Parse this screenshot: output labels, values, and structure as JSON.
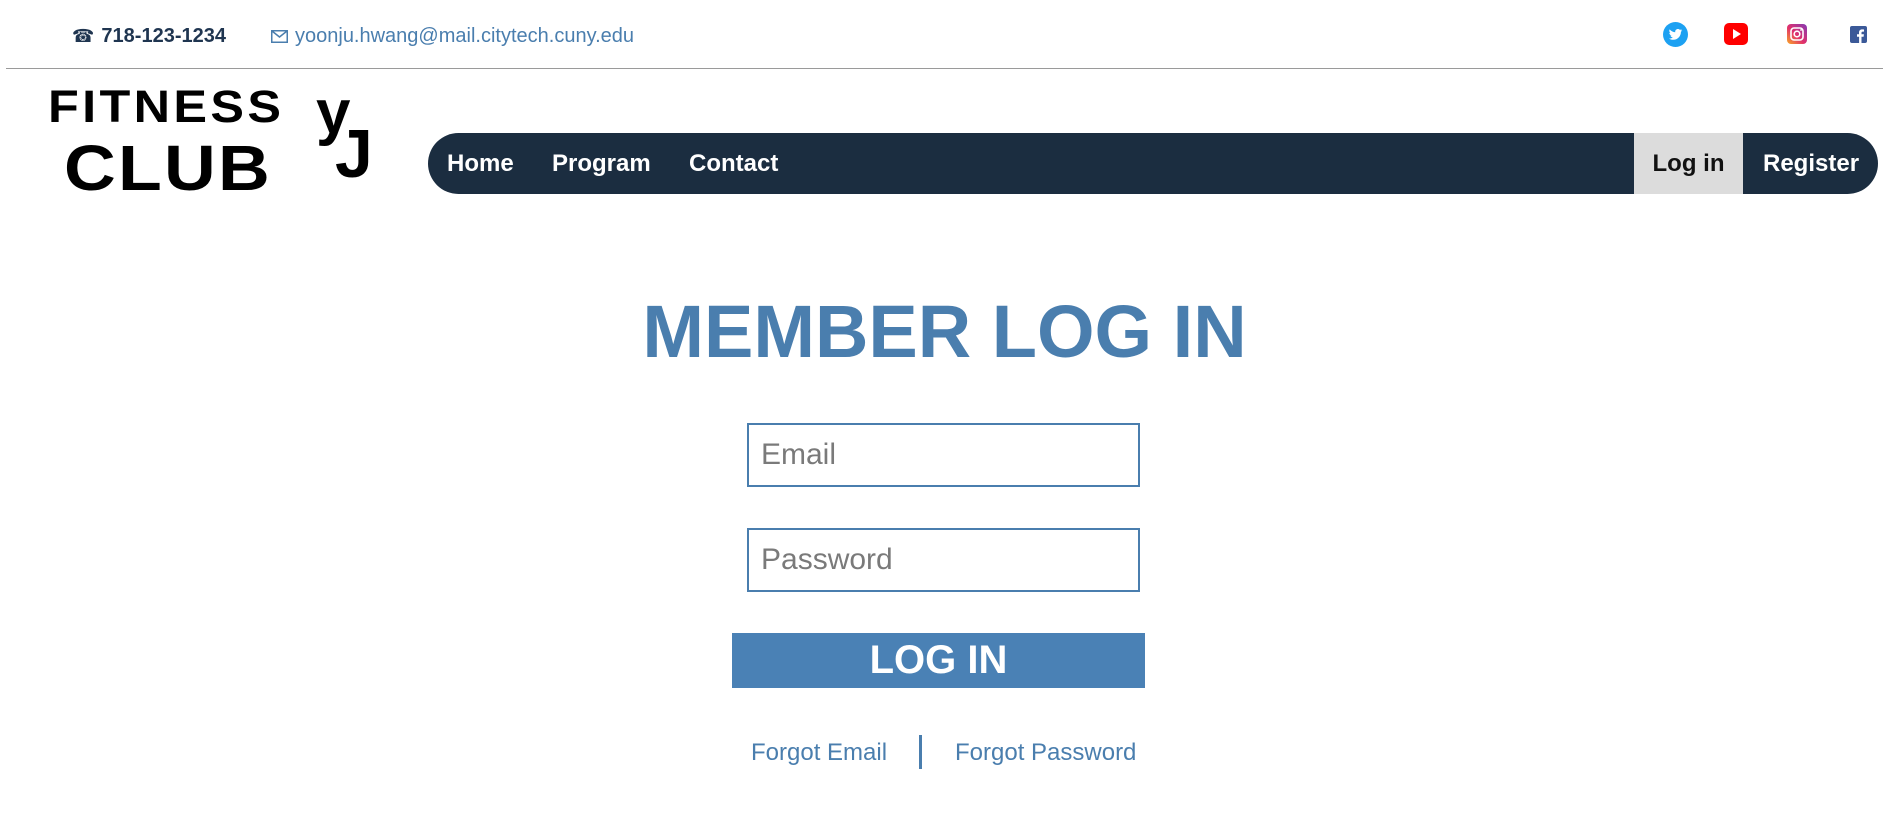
{
  "header": {
    "phone": "718-123-1234",
    "email": "yoonju.hwang@mail.citytech.cuny.edu",
    "phone_icon": "☎",
    "social_icons": [
      "twitter-icon",
      "youtube-icon",
      "instagram-icon",
      "facebook-icon"
    ]
  },
  "logo": {
    "line1": "FITNESS",
    "line2": "CLUB",
    "mark_y": "y",
    "mark_j": "J"
  },
  "nav": {
    "items": [
      {
        "label": "Home"
      },
      {
        "label": "Program"
      },
      {
        "label": "Contact"
      }
    ],
    "login": "Log in",
    "register": "Register"
  },
  "main": {
    "title": "MEMBER LOG IN",
    "email_placeholder": "Email",
    "password_placeholder": "Password",
    "login_button": "LOG IN",
    "forgot_email": "Forgot Email",
    "forgot_password": "Forgot Password"
  },
  "colors": {
    "accent": "#4a7eae",
    "nav_bg": "#1b2d40",
    "active_nav_bg": "#dcdcdc",
    "button_bg": "#4a81b5",
    "twitter": "#1da1f2",
    "youtube": "#ff0000",
    "instagram": "#c13584",
    "facebook": "#3b5998"
  }
}
